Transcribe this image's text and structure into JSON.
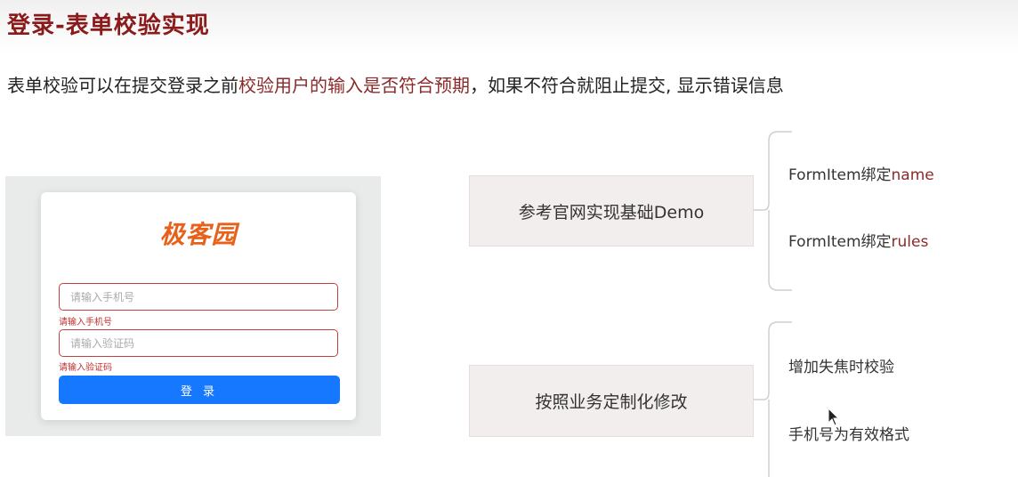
{
  "slide": {
    "title": "登录-表单校验实现",
    "subtitle": {
      "part1": "表单校验可以在提交登录之前",
      "highlight": "校验用户的输入是否符合预期",
      "part2": "，如果不符合就阻止提交, 显示错误信息"
    }
  },
  "login": {
    "logo": "极客园",
    "phone_placeholder": "请输入手机号",
    "phone_error": "请输入手机号",
    "code_placeholder": "请输入验证码",
    "code_error": "请输入验证码",
    "login_label": "登 录"
  },
  "mindmap": {
    "node1": {
      "label": "参考官网实现基础Demo",
      "branches": [
        {
          "prefix": "FormItem绑定",
          "highlight": "name"
        },
        {
          "prefix": "FormItem绑定",
          "highlight": "rules"
        }
      ]
    },
    "node2": {
      "label": "按照业务定制化修改",
      "branches": [
        {
          "text": "增加失焦时校验"
        },
        {
          "text": "手机号为有效格式"
        }
      ]
    }
  },
  "colors": {
    "title": "#8b1a1a",
    "highlight": "#8b2a2a",
    "error": "#c0302f",
    "primary_button": "#1677ff",
    "logo": "#e8611a"
  }
}
